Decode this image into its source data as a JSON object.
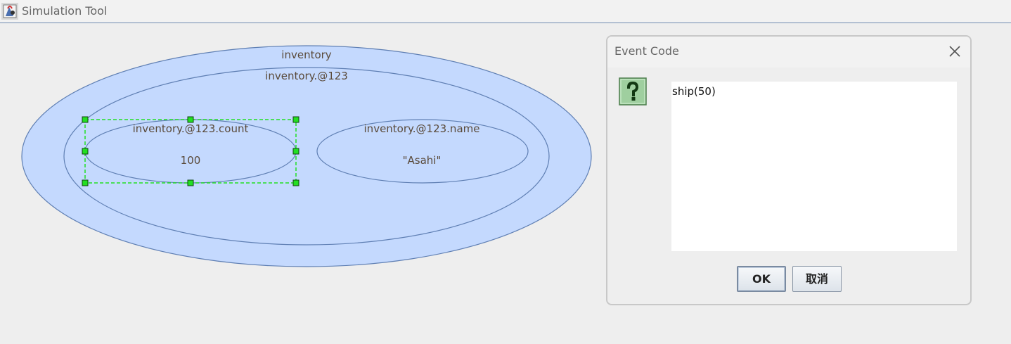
{
  "window": {
    "title": "Simulation Tool",
    "icon": "java-app-icon"
  },
  "diagram": {
    "outer_label": "inventory",
    "inner_label": "inventory.@123",
    "count_label": "inventory.@123.count",
    "count_value": "100",
    "name_label": "inventory.@123.name",
    "name_value": "\"Asahi\"",
    "fill_color": "#c4d9fe",
    "stroke_color": "#5f7fb3",
    "selection_color": "#22e022"
  },
  "dialog": {
    "title": "Event Code",
    "close_icon": "close-icon",
    "question_icon": "question-icon",
    "code": "ship(50)",
    "ok_label": "OK",
    "cancel_label": "取消"
  }
}
